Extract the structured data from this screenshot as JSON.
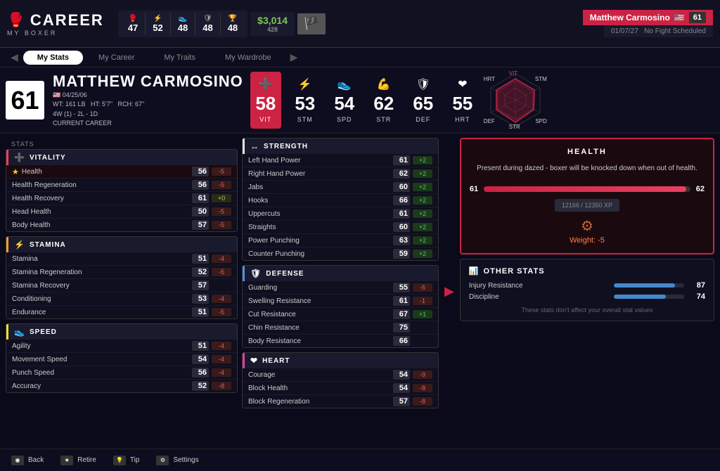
{
  "app": {
    "title": "CAREER",
    "subtitle": "MY BOXER"
  },
  "topStats": {
    "items": [
      {
        "icon": "🥊",
        "val": "47"
      },
      {
        "icon": "💪",
        "val": "52"
      },
      {
        "icon": "👟",
        "val": "48"
      },
      {
        "icon": "🛡",
        "val": "48"
      },
      {
        "icon": "❤",
        "val": ""
      }
    ],
    "money": "$3,014",
    "moneyLabel": "428",
    "date": "01/07/27"
  },
  "playerName": "Matthew Carmosino",
  "playerFlag": "🇺🇸",
  "playerRank": "61",
  "fightStatus": "No Fight Scheduled",
  "tabs": [
    {
      "label": "My Stats",
      "active": true
    },
    {
      "label": "My Career",
      "active": false
    },
    {
      "label": "My Traits",
      "active": false
    },
    {
      "label": "My Wardrobe",
      "active": false
    }
  ],
  "boxer": {
    "overall": "61",
    "name": "MATTHEW CARMOSINO",
    "dob": "04/25/06",
    "weight": "WT: 161 LB",
    "height": "HT: 5'7\"",
    "reach": "RCH: 67\"",
    "record": "4W (1) - 2L - 1D",
    "career": "CURRENT CAREER"
  },
  "mainStats": [
    {
      "icon": "➕",
      "val": "58",
      "label": "VIT",
      "highlighted": true
    },
    {
      "icon": "⚡",
      "val": "53",
      "label": "STM",
      "highlighted": false
    },
    {
      "icon": "👟",
      "val": "54",
      "label": "SPD",
      "highlighted": false
    },
    {
      "icon": "💪",
      "val": "62",
      "label": "STR",
      "highlighted": false
    },
    {
      "icon": "🛡",
      "val": "65",
      "label": "DEF",
      "highlighted": false
    },
    {
      "icon": "❤",
      "val": "55",
      "label": "HRT",
      "highlighted": false
    }
  ],
  "hexLabels": {
    "VIT": "VIT",
    "STM": "STM",
    "SPD": "SPD",
    "STR": "STR",
    "DEF": "DEF",
    "HRT": "HRT"
  },
  "vitality": {
    "header": "VITALITY",
    "icon": "➕",
    "stats": [
      {
        "name": "Health",
        "val": "56",
        "change": "-5",
        "type": "neg",
        "starred": true
      },
      {
        "name": "Health Regeneration",
        "val": "56",
        "change": "-5",
        "type": "neg"
      },
      {
        "name": "Health Recovery",
        "val": "61",
        "change": "+0",
        "type": "neutral"
      },
      {
        "name": "Head Health",
        "val": "50",
        "change": "-5",
        "type": "neg"
      },
      {
        "name": "Body Health",
        "val": "57",
        "change": "-5",
        "type": "neg"
      }
    ]
  },
  "stamina": {
    "header": "STAMINA",
    "icon": "⚡",
    "stats": [
      {
        "name": "Stamina",
        "val": "51",
        "change": "-4",
        "type": "neg"
      },
      {
        "name": "Stamina Regeneration",
        "val": "52",
        "change": "-5",
        "type": "neg"
      },
      {
        "name": "Stamina Recovery",
        "val": "57",
        "change": "",
        "type": "none"
      },
      {
        "name": "Conditioning",
        "val": "53",
        "change": "-4",
        "type": "neg"
      },
      {
        "name": "Endurance",
        "val": "51",
        "change": "-5",
        "type": "neg"
      }
    ]
  },
  "speed": {
    "header": "SPEED",
    "icon": "👟",
    "stats": [
      {
        "name": "Agility",
        "val": "51",
        "change": "-4",
        "type": "neg"
      },
      {
        "name": "Movement Speed",
        "val": "54",
        "change": "-4",
        "type": "neg"
      },
      {
        "name": "Punch Speed",
        "val": "56",
        "change": "-4",
        "type": "neg"
      },
      {
        "name": "Accuracy",
        "val": "52",
        "change": "-8",
        "type": "neg"
      }
    ]
  },
  "strength": {
    "header": "STRENGTH",
    "icon": "💪",
    "stats": [
      {
        "name": "Left Hand Power",
        "val": "61",
        "change": "+2",
        "type": "pos"
      },
      {
        "name": "Right Hand Power",
        "val": "62",
        "change": "+2",
        "type": "pos"
      },
      {
        "name": "Jabs",
        "val": "60",
        "change": "+2",
        "type": "pos"
      },
      {
        "name": "Hooks",
        "val": "66",
        "change": "+2",
        "type": "pos"
      },
      {
        "name": "Uppercuts",
        "val": "61",
        "change": "+2",
        "type": "pos"
      },
      {
        "name": "Straights",
        "val": "60",
        "change": "+2",
        "type": "pos"
      },
      {
        "name": "Power Punching",
        "val": "63",
        "change": "+2",
        "type": "pos"
      },
      {
        "name": "Counter Punching",
        "val": "59",
        "change": "+2",
        "type": "pos"
      }
    ]
  },
  "defense": {
    "header": "DEFENSE",
    "icon": "🛡",
    "stats": [
      {
        "name": "Guarding",
        "val": "55",
        "change": "-5",
        "type": "neg"
      },
      {
        "name": "Swelling Resistance",
        "val": "61",
        "change": "-1",
        "type": "neg"
      },
      {
        "name": "Cut Resistance",
        "val": "67",
        "change": "+1",
        "type": "pos"
      },
      {
        "name": "Chin Resistance",
        "val": "75",
        "change": "",
        "type": "none"
      },
      {
        "name": "Body Resistance",
        "val": "66",
        "change": "",
        "type": "none"
      }
    ]
  },
  "heart": {
    "header": "HEART",
    "icon": "❤",
    "stats": [
      {
        "name": "Courage",
        "val": "54",
        "change": "-9",
        "type": "neg"
      },
      {
        "name": "Block Health",
        "val": "54",
        "change": "-8",
        "type": "neg"
      },
      {
        "name": "Block Regeneration",
        "val": "57",
        "change": "-8",
        "type": "neg"
      }
    ]
  },
  "healthPanel": {
    "title": "HEALTH",
    "description": "Present during dazed - boxer will be knocked down when out of health.",
    "currentVal": "61",
    "nextVal": "62",
    "barPercent": 98,
    "xp": "12166 / 12350 XP",
    "xpPercent": 98,
    "weightChange": "Weight: -5"
  },
  "otherStats": {
    "title": "OTHER STATS",
    "stats": [
      {
        "name": "Injury Resistance",
        "val": "87",
        "barPct": 87
      },
      {
        "name": "Discipline",
        "val": "74",
        "barPct": 74
      }
    ],
    "note": "These stats don't affect your overall stat values"
  },
  "bottomBar": {
    "buttons": [
      {
        "icon": "◉",
        "label": "Back"
      },
      {
        "icon": "★",
        "label": "Retire"
      },
      {
        "icon": "💡",
        "label": "Tip"
      },
      {
        "icon": "⚙",
        "label": "Settings"
      }
    ]
  }
}
